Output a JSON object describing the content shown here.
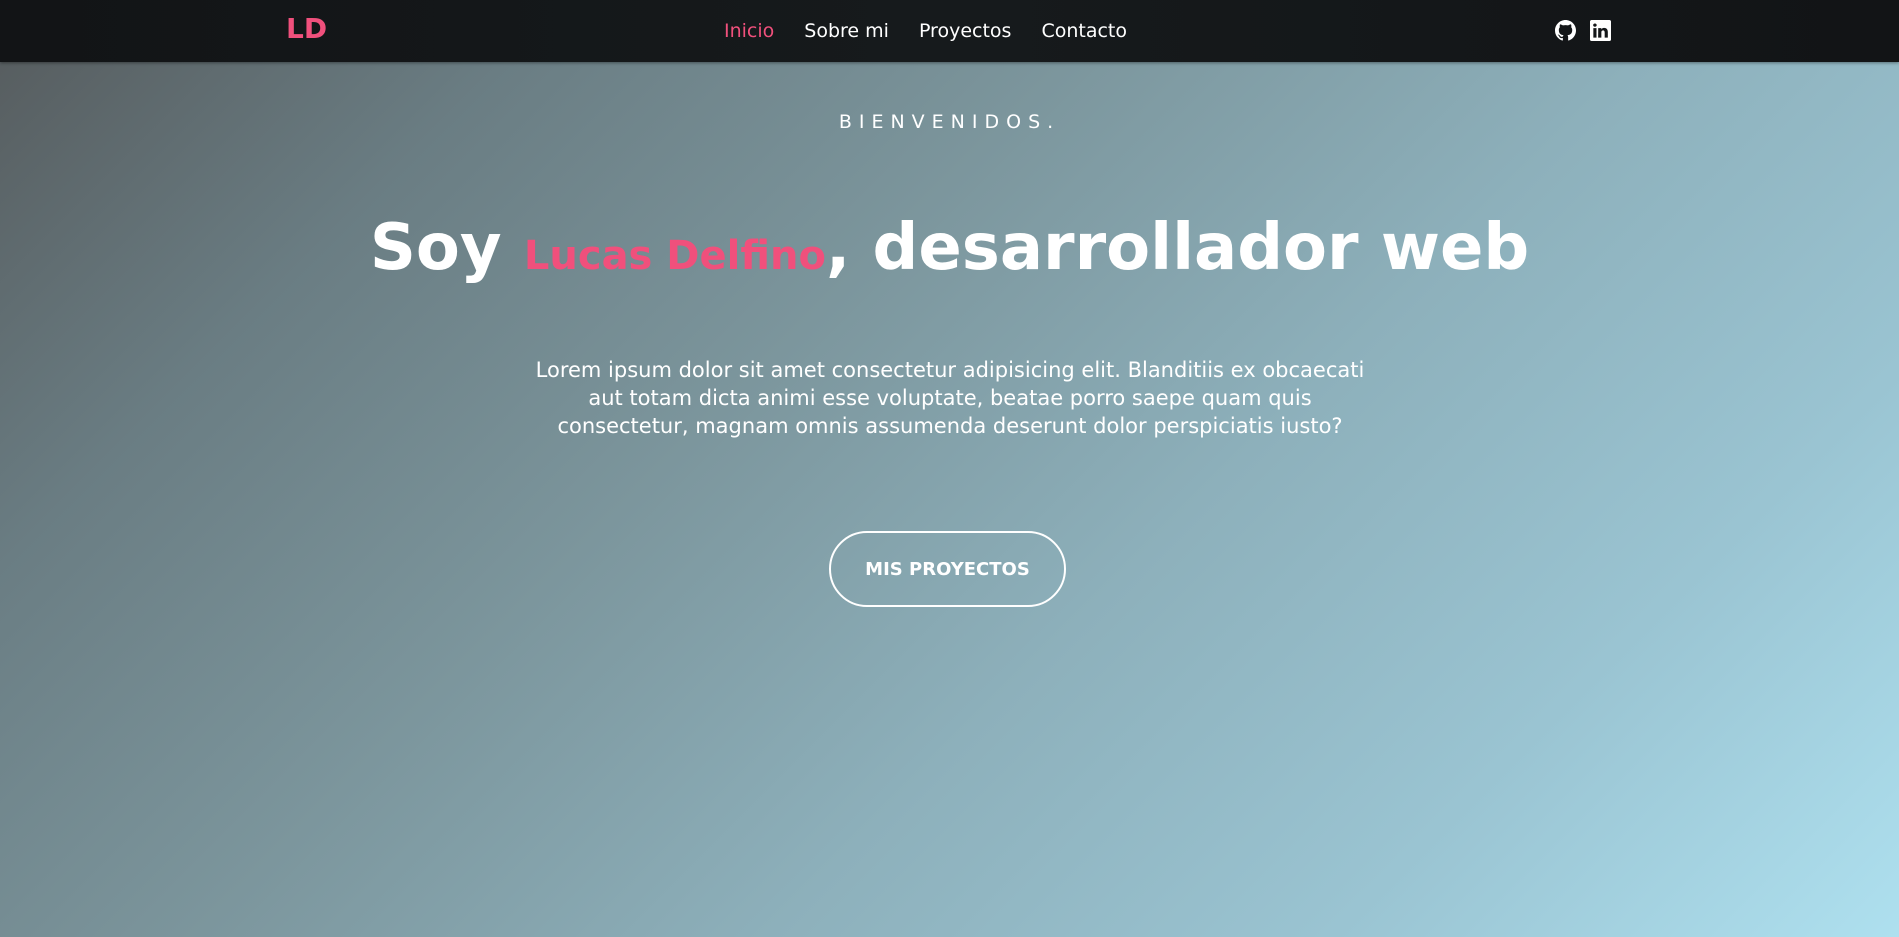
{
  "navbar": {
    "logo": "LD",
    "links": [
      {
        "label": "Inicio",
        "active": true
      },
      {
        "label": "Sobre mi",
        "active": false
      },
      {
        "label": "Proyectos",
        "active": false
      },
      {
        "label": "Contacto",
        "active": false
      }
    ],
    "social": [
      {
        "icon": "github-icon"
      },
      {
        "icon": "linkedin-icon"
      }
    ]
  },
  "hero": {
    "greeting": "BIENVENIDOS.",
    "headline_prefix": "Soy ",
    "headline_name": "Lucas Delfino",
    "headline_suffix": ", desarrollador web",
    "description": "Lorem ipsum dolor sit amet consectetur adipisicing elit. Blanditiis ex obcaecati aut totam dicta animi esse voluptate, beatae porro saepe quam quis consectetur, magnam omnis assumenda deserunt dolor perspiciatis iusto?",
    "cta_label": "MIS PROYECTOS"
  },
  "colors": {
    "accent": "#f0507c",
    "navbar_bg": "#141719",
    "text": "#ffffff"
  }
}
